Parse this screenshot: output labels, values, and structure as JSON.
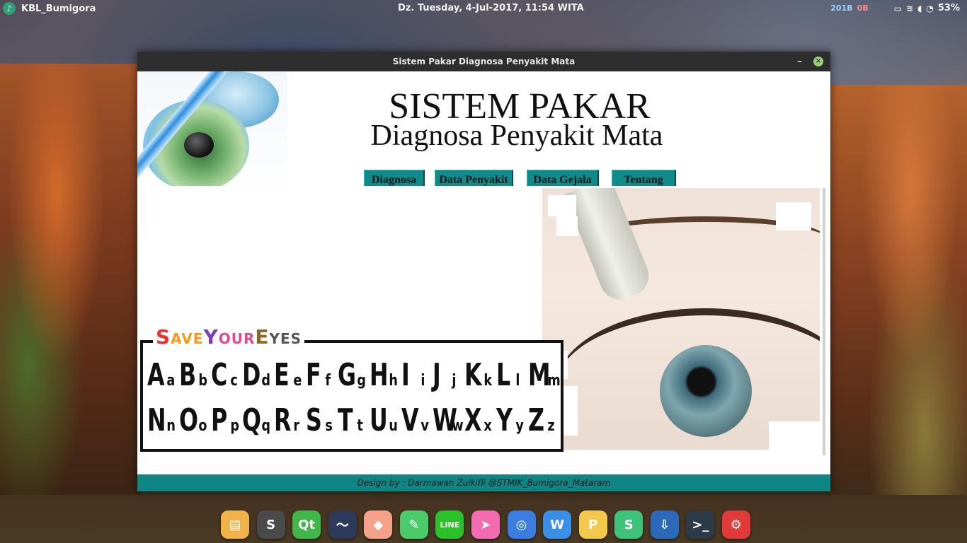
{
  "topbar": {
    "app_name": "KBL_Bumigora",
    "clock": "Dz. Tuesday,  4-Jul-2017, 11:54 WITA",
    "net_up": "201B",
    "net_down": "0B",
    "battery": "53%"
  },
  "window": {
    "title": "Sistem Pakar Diagnosa Penyakit Mata",
    "minimize_label": "–",
    "close_label": "×"
  },
  "header": {
    "title_main": "SISTEM PAKAR",
    "title_sub": "Diagnosa Penyakit Mata",
    "nav": [
      {
        "label": "Diagnosa"
      },
      {
        "label": "Data Penyakit"
      },
      {
        "label": "Data Gejala"
      },
      {
        "label": "Tentang"
      }
    ]
  },
  "poster": {
    "title_parts": [
      "S",
      "AVE",
      "Y",
      "OUR",
      "E",
      "YES"
    ],
    "row1": [
      [
        "A",
        "a"
      ],
      [
        "B",
        "b"
      ],
      [
        "C",
        "c"
      ],
      [
        "D",
        "d"
      ],
      [
        "E",
        "e"
      ],
      [
        "F",
        "f"
      ],
      [
        "G",
        "g"
      ],
      [
        "H",
        "h"
      ],
      [
        "I",
        "i"
      ],
      [
        "J",
        "j"
      ],
      [
        "K",
        "k"
      ],
      [
        "L",
        "l"
      ],
      [
        "M",
        "m"
      ]
    ],
    "row2": [
      [
        "N",
        "n"
      ],
      [
        "O",
        "o"
      ],
      [
        "P",
        "p"
      ],
      [
        "Q",
        "q"
      ],
      [
        "R",
        "r"
      ],
      [
        "S",
        "s"
      ],
      [
        "T",
        "t"
      ],
      [
        "U",
        "u"
      ],
      [
        "V",
        "v"
      ],
      [
        "W",
        "w"
      ],
      [
        "X",
        "x"
      ],
      [
        "Y",
        "y"
      ],
      [
        "Z",
        "z"
      ]
    ]
  },
  "footer": {
    "credit": "Design by : Darmawan Zulkifli @STMIK_Bumigora_Mataram"
  },
  "dock": [
    {
      "icon": "files-icon",
      "color": "#f2b24a",
      "glyph": "▤"
    },
    {
      "icon": "sublime-text-icon",
      "color": "#4a4a4a",
      "glyph": "S"
    },
    {
      "icon": "qt-creator-icon",
      "color": "#41b649",
      "glyph": "Qt"
    },
    {
      "icon": "mysql-workbench-icon",
      "color": "#2d3a5a",
      "glyph": "〜"
    },
    {
      "icon": "inkscape-icon",
      "color": "#f4a38a",
      "glyph": "◆"
    },
    {
      "icon": "screenshot-icon",
      "color": "#4ccb6a",
      "glyph": "✎"
    },
    {
      "icon": "line-icon",
      "color": "#2bc12b",
      "glyph": "LINE"
    },
    {
      "icon": "send-icon",
      "color": "#f36bb0",
      "glyph": "➤"
    },
    {
      "icon": "chromium-icon",
      "color": "#3b7de0",
      "glyph": "◎"
    },
    {
      "icon": "wps-writer-icon",
      "color": "#3a8fe6",
      "glyph": "W"
    },
    {
      "icon": "wps-presentation-icon",
      "color": "#f2c94c",
      "glyph": "P"
    },
    {
      "icon": "wps-spreadsheet-icon",
      "color": "#3fc27a",
      "glyph": "S"
    },
    {
      "icon": "install-icon",
      "color": "#2a6ab8",
      "glyph": "⇩"
    },
    {
      "icon": "terminal-icon",
      "color": "#2d3b48",
      "glyph": ">_"
    },
    {
      "icon": "settings-icon",
      "color": "#e03a3a",
      "glyph": "⚙"
    }
  ]
}
